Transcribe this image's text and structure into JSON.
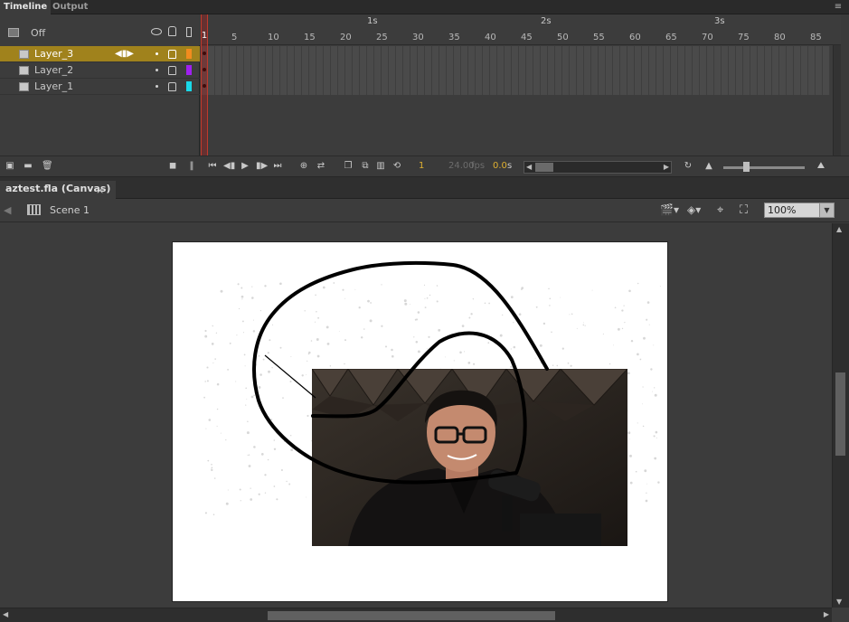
{
  "panel_tabs": {
    "timeline": "Timeline",
    "output": "Output"
  },
  "timeline": {
    "layers_header_label": "Off",
    "layers": [
      {
        "name": "Layer_3",
        "color": "#f28c1e",
        "selected": true
      },
      {
        "name": "Layer_2",
        "color": "#a020f0",
        "selected": false
      },
      {
        "name": "Layer_1",
        "color": "#19d8e8",
        "selected": false
      }
    ],
    "seconds_labels": [
      "1s",
      "2s",
      "3s"
    ],
    "frame_tick_labels": [
      "5",
      "10",
      "15",
      "20",
      "25",
      "30",
      "35",
      "40",
      "45",
      "50",
      "55",
      "60",
      "65",
      "70",
      "75",
      "80",
      "85"
    ],
    "current_frame": "1",
    "playhead_label": "1",
    "fps": "24.00",
    "fps_unit": "fps",
    "elapsed": "0.0",
    "elapsed_unit": "s"
  },
  "document": {
    "tab_title": "aztest.fla (Canvas)",
    "close_glyph": "×",
    "scene_label": "Scene 1",
    "zoom": "100%"
  },
  "colors": {
    "accent_selected_layer": "#a0821c",
    "playhead": "#c0392b",
    "frame_number": "#e0b030"
  }
}
